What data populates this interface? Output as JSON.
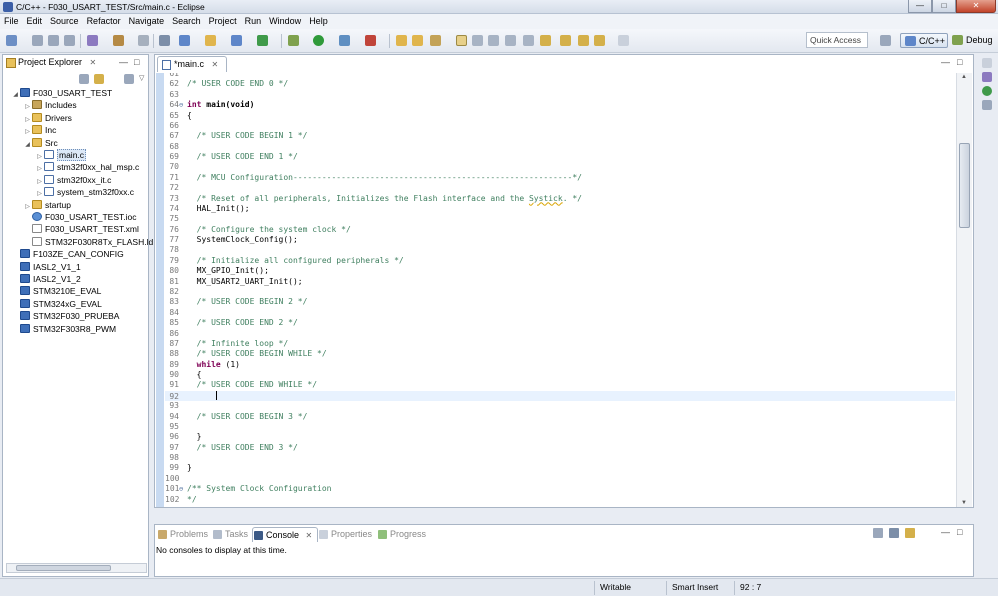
{
  "window": {
    "title": "C/C++ - F030_USART_TEST/Src/main.c - Eclipse",
    "minimize": "—",
    "maximize": "□",
    "close": "✕"
  },
  "menu": [
    "File",
    "Edit",
    "Source",
    "Refactor",
    "Navigate",
    "Search",
    "Project",
    "Run",
    "Window",
    "Help"
  ],
  "toolbar": {
    "quick_access_placeholder": "Quick Access",
    "perspectives": [
      {
        "label": "C/C++",
        "active": true
      },
      {
        "label": "Debug",
        "active": false
      }
    ]
  },
  "project_explorer": {
    "tab_label": "Project Explorer",
    "close_glyph": "✕",
    "min_glyph": "—",
    "max_glyph": "□",
    "tree": [
      {
        "label": "F030_USART_TEST",
        "depth": 0,
        "expanded": true,
        "icon": "project-icon"
      },
      {
        "label": "Includes",
        "depth": 1,
        "expanded": false,
        "icon": "includes-icon"
      },
      {
        "label": "Drivers",
        "depth": 1,
        "expanded": false,
        "icon": "folder-icon"
      },
      {
        "label": "Inc",
        "depth": 1,
        "expanded": false,
        "icon": "folder-icon"
      },
      {
        "label": "Src",
        "depth": 1,
        "expanded": true,
        "icon": "folder-icon"
      },
      {
        "label": "main.c",
        "depth": 2,
        "expanded": false,
        "icon": "c-file-icon",
        "selected": true
      },
      {
        "label": "stm32f0xx_hal_msp.c",
        "depth": 2,
        "expanded": false,
        "icon": "c-file-icon"
      },
      {
        "label": "stm32f0xx_it.c",
        "depth": 2,
        "expanded": false,
        "icon": "c-file-icon"
      },
      {
        "label": "system_stm32f0xx.c",
        "depth": 2,
        "expanded": false,
        "icon": "c-file-icon"
      },
      {
        "label": "startup",
        "depth": 1,
        "expanded": false,
        "icon": "folder-icon"
      },
      {
        "label": "F030_USART_TEST.ioc",
        "depth": 1,
        "icon": "ioc-file-icon"
      },
      {
        "label": "F030_USART_TEST.xml",
        "depth": 1,
        "icon": "xml-file-icon"
      },
      {
        "label": "STM32F030R8Tx_FLASH.ld",
        "depth": 1,
        "icon": "ld-file-icon"
      },
      {
        "label": "F103ZE_CAN_CONFIG",
        "depth": 0,
        "icon": "project-icon"
      },
      {
        "label": "IASL2_V1_1",
        "depth": 0,
        "icon": "project-icon"
      },
      {
        "label": "IASL2_V1_2",
        "depth": 0,
        "icon": "project-icon"
      },
      {
        "label": "STM3210E_EVAL",
        "depth": 0,
        "icon": "project-icon"
      },
      {
        "label": "STM324xG_EVAL",
        "depth": 0,
        "icon": "project-icon"
      },
      {
        "label": "STM32F030_PRUEBA",
        "depth": 0,
        "icon": "project-icon"
      },
      {
        "label": "STM32F303R8_PWM",
        "depth": 0,
        "icon": "project-icon"
      }
    ]
  },
  "editor": {
    "tab_label": "*main.c",
    "close_glyph": "✕",
    "lines": [
      {
        "n": "61",
        "t": "",
        "cls": ""
      },
      {
        "n": "62",
        "t": "/* USER CODE END 0 */",
        "cls": "cm"
      },
      {
        "n": "63",
        "t": "",
        "cls": ""
      },
      {
        "n": "64",
        "t": "int main(void)",
        "cls": "main",
        "fold": "⊖"
      },
      {
        "n": "65",
        "t": "{",
        "cls": ""
      },
      {
        "n": "66",
        "t": "",
        "cls": ""
      },
      {
        "n": "67",
        "t": "  /* USER CODE BEGIN 1 */",
        "cls": "cm"
      },
      {
        "n": "68",
        "t": "",
        "cls": ""
      },
      {
        "n": "69",
        "t": "  /* USER CODE END 1 */",
        "cls": "cm"
      },
      {
        "n": "70",
        "t": "",
        "cls": ""
      },
      {
        "n": "71",
        "t": "  /* MCU Configuration----------------------------------------------------------*/",
        "cls": "cm"
      },
      {
        "n": "72",
        "t": "",
        "cls": ""
      },
      {
        "n": "73",
        "t": "  /* Reset of all peripherals, Initializes the Flash interface and the Systick. */",
        "cls": "cm-squig"
      },
      {
        "n": "74",
        "t": "  HAL_Init();",
        "cls": ""
      },
      {
        "n": "75",
        "t": "",
        "cls": ""
      },
      {
        "n": "76",
        "t": "  /* Configure the system clock */",
        "cls": "cm"
      },
      {
        "n": "77",
        "t": "  SystemClock_Config();",
        "cls": ""
      },
      {
        "n": "78",
        "t": "",
        "cls": ""
      },
      {
        "n": "79",
        "t": "  /* Initialize all configured peripherals */",
        "cls": "cm"
      },
      {
        "n": "80",
        "t": "  MX_GPIO_Init();",
        "cls": ""
      },
      {
        "n": "81",
        "t": "  MX_USART2_UART_Init();",
        "cls": ""
      },
      {
        "n": "82",
        "t": "",
        "cls": ""
      },
      {
        "n": "83",
        "t": "  /* USER CODE BEGIN 2 */",
        "cls": "cm"
      },
      {
        "n": "84",
        "t": "",
        "cls": ""
      },
      {
        "n": "85",
        "t": "  /* USER CODE END 2 */",
        "cls": "cm"
      },
      {
        "n": "86",
        "t": "",
        "cls": ""
      },
      {
        "n": "87",
        "t": "  /* Infinite loop */",
        "cls": "cm"
      },
      {
        "n": "88",
        "t": "  /* USER CODE BEGIN WHILE */",
        "cls": "cm"
      },
      {
        "n": "89",
        "t": "  while (1)",
        "cls": "while"
      },
      {
        "n": "90",
        "t": "  {",
        "cls": ""
      },
      {
        "n": "91",
        "t": "  /* USER CODE END WHILE */",
        "cls": "cm"
      },
      {
        "n": "92",
        "t": "      ",
        "cls": "caret"
      },
      {
        "n": "93",
        "t": "",
        "cls": ""
      },
      {
        "n": "94",
        "t": "  /* USER CODE BEGIN 3 */",
        "cls": "cm"
      },
      {
        "n": "95",
        "t": "",
        "cls": ""
      },
      {
        "n": "96",
        "t": "  }",
        "cls": ""
      },
      {
        "n": "97",
        "t": "  /* USER CODE END 3 */",
        "cls": "cm"
      },
      {
        "n": "98",
        "t": "",
        "cls": ""
      },
      {
        "n": "99",
        "t": "}",
        "cls": ""
      },
      {
        "n": "100",
        "t": "",
        "cls": ""
      },
      {
        "n": "101",
        "t": "/** System Clock Configuration",
        "cls": "cm",
        "fold": "⊖"
      },
      {
        "n": "102",
        "t": "*/",
        "cls": "cm"
      }
    ]
  },
  "bottom_panel": {
    "tabs": [
      {
        "label": "Problems",
        "active": false
      },
      {
        "label": "Tasks",
        "active": false
      },
      {
        "label": "Console",
        "active": true
      },
      {
        "label": "Properties",
        "active": false
      },
      {
        "label": "Progress",
        "active": false
      }
    ],
    "close_glyph": "✕",
    "message": "No consoles to display at this time."
  },
  "status_bar": {
    "writable": "Writable",
    "insert_mode": "Smart Insert",
    "position": "92 : 7"
  },
  "colors": {
    "comment": "#3f7f5f",
    "keyword": "#7f0055",
    "line_number": "#787878",
    "current_line": "#e8f2fe"
  }
}
